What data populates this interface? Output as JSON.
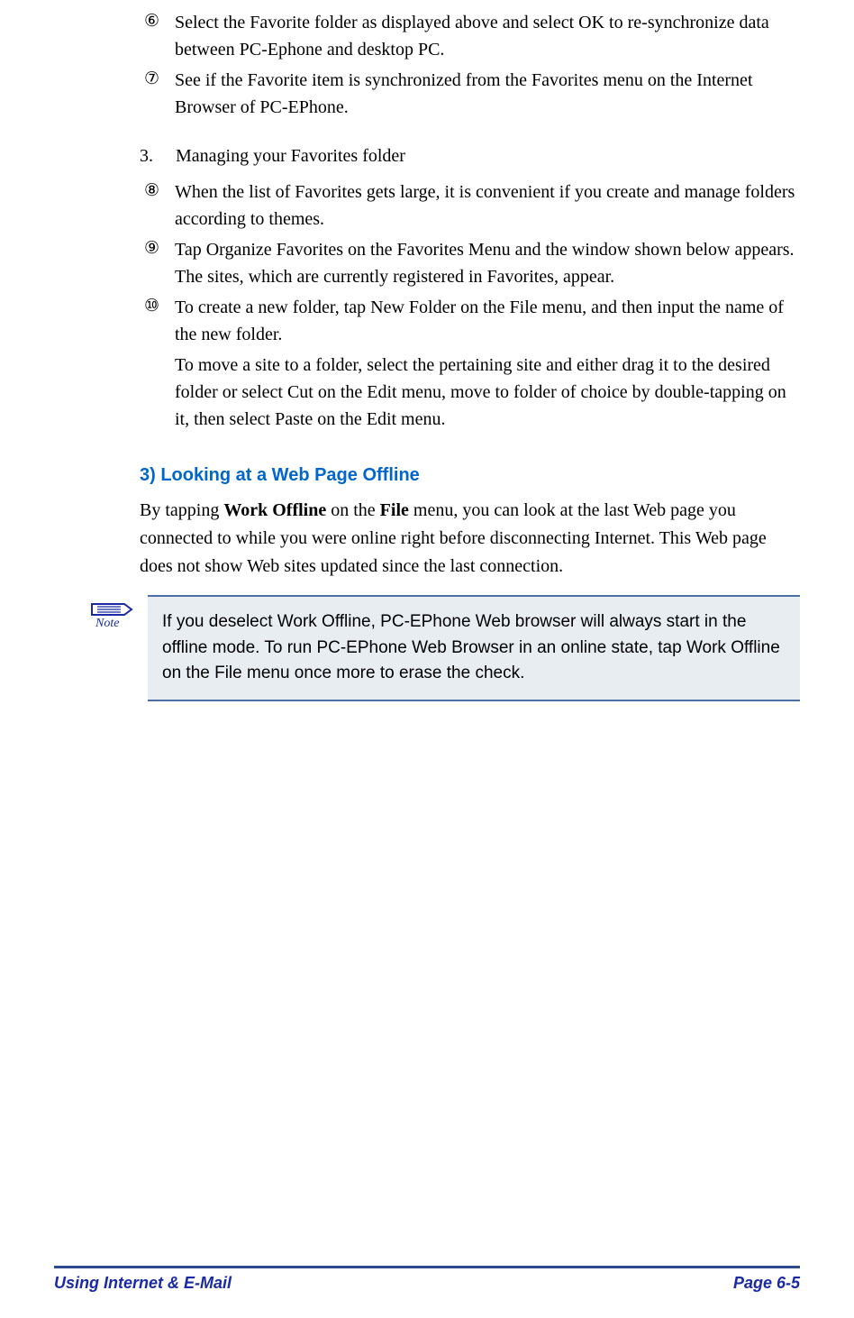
{
  "items_top": [
    {
      "marker": "⑥",
      "text": "Select the Favorite folder as displayed above and select OK to re-synchronize data between PC-Ephone and desktop PC."
    },
    {
      "marker": "⑦",
      "text": "See if the Favorite item is synchronized from the Favorites menu on the Internet Browser of PC-EPhone."
    }
  ],
  "numbered": {
    "marker": "3.",
    "text": "Managing your Favorites folder"
  },
  "items_mid": [
    {
      "marker": "⑧",
      "text": "When the list of Favorites gets large, it is convenient if you create and manage folders according to themes."
    },
    {
      "marker": "⑨",
      "text": "Tap Organize Favorites on the Favorites Menu and the window shown below appears. The sites, which are currently registered in Favorites, appear."
    },
    {
      "marker": "⑩",
      "text": "To create a new folder, tap New Folder on the File menu, and then input the name of the new folder."
    },
    {
      "marker": "  ",
      "text": "To move a site to a folder, select the pertaining site and either drag it to the desired folder or select Cut on the Edit menu, move to folder of choice by double-tapping on it, then select Paste on the Edit menu."
    }
  ],
  "section": {
    "heading": "3)   Looking at a Web Page Offline",
    "para_pre": "By tapping ",
    "para_bold1": "Work Offline",
    "para_mid": " on the ",
    "para_bold2": "File",
    "para_post": " menu, you can look at the last Web page you connected to while you were online right before disconnecting Internet. This Web page does not show Web sites updated since the last connection."
  },
  "note": {
    "label": "Note",
    "text": "If you deselect Work Offline, PC-EPhone Web browser will always start in the offline mode. To run PC-EPhone Web Browser in an online state, tap Work Offline on the File menu once more to erase the check."
  },
  "footer": {
    "left": "Using Internet & E-Mail",
    "right": "Page 6-5"
  }
}
